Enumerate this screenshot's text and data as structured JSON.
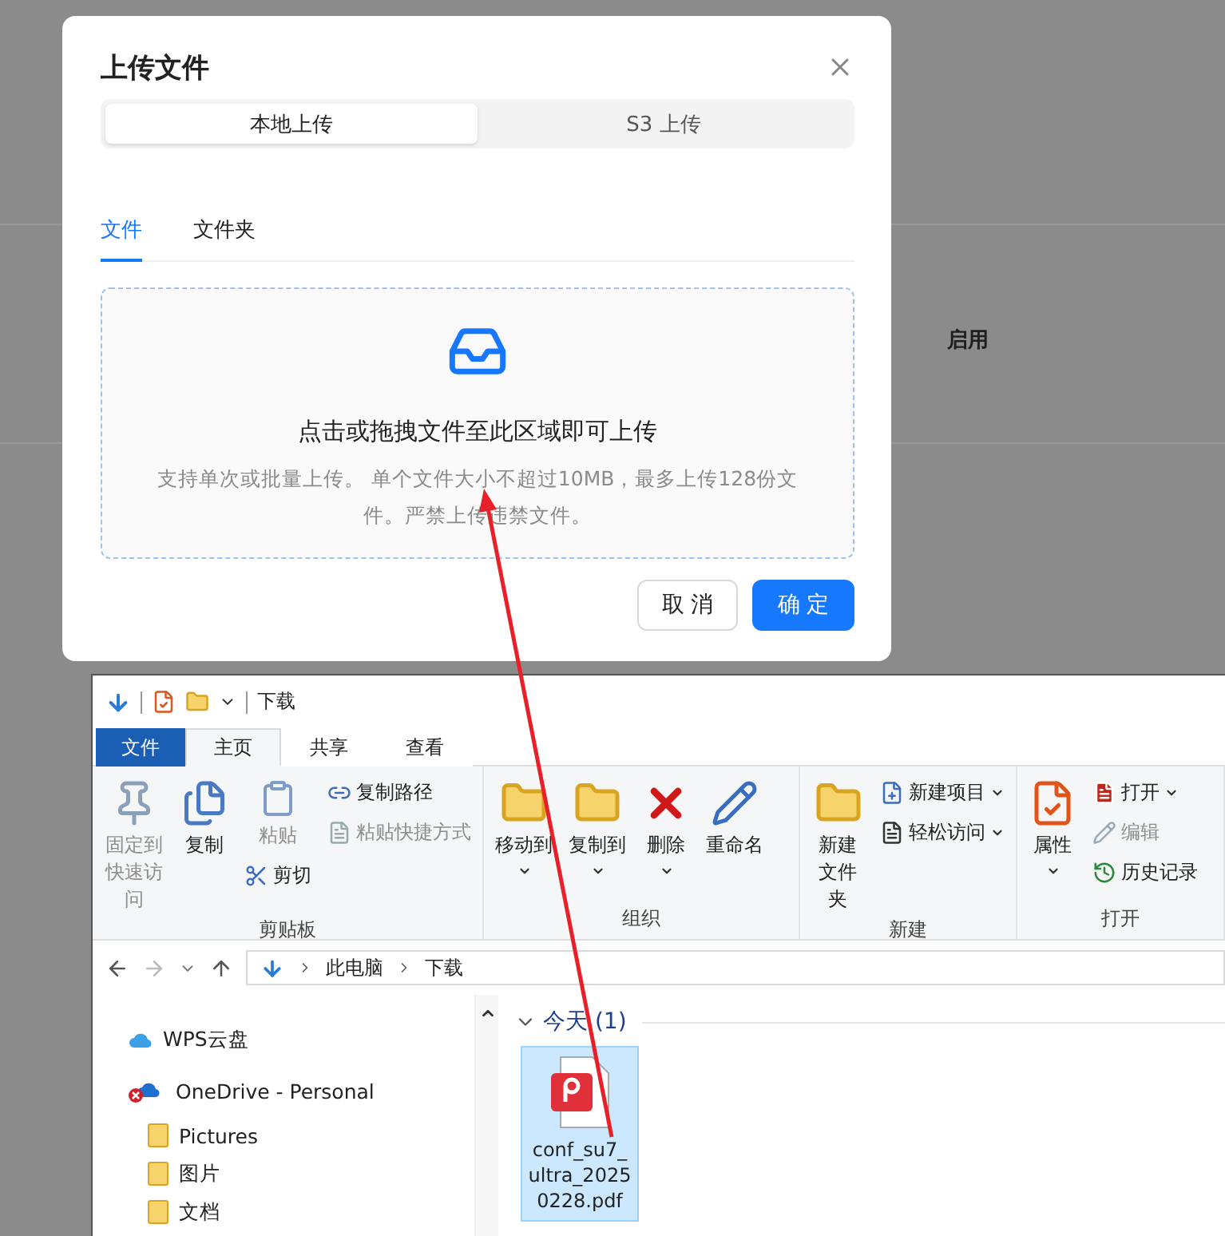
{
  "background": {
    "column_header": "启用"
  },
  "dialog": {
    "title": "上传文件",
    "source_tabs": [
      {
        "label": "本地上传",
        "selected": true
      },
      {
        "label": "S3 上传",
        "selected": false
      }
    ],
    "tabs": [
      {
        "label": "文件",
        "selected": true
      },
      {
        "label": "文件夹",
        "selected": false
      }
    ],
    "dropzone": {
      "title": "点击或拖拽文件至此区域即可上传",
      "hint": "支持单次或批量上传。 单个文件大小不超过10MB，最多上传128份文件。严禁上传违禁文件。"
    },
    "buttons": [
      {
        "label": "取 消",
        "kind": "default"
      },
      {
        "label": "确 定",
        "kind": "primary"
      }
    ]
  },
  "explorer": {
    "title": "下载",
    "ribbon_tabs": [
      {
        "label": "文件",
        "kind": "file",
        "selected": false
      },
      {
        "label": "主页",
        "kind": "tab",
        "selected": true
      },
      {
        "label": "共享",
        "kind": "tab",
        "selected": false
      },
      {
        "label": "查看",
        "kind": "tab",
        "selected": false
      }
    ],
    "ribbon_groups": [
      {
        "label": "剪贴板",
        "columns": [
          [
            {
              "kind": "large",
              "label": "固定到快速访问",
              "disabled": true,
              "dropdown": false
            }
          ],
          [
            {
              "kind": "large",
              "label": "复制",
              "disabled": false,
              "dropdown": false
            }
          ],
          [
            {
              "kind": "medium",
              "label": "粘贴",
              "disabled": true,
              "dropdown": false
            },
            {
              "kind": "small",
              "label": "剪切",
              "disabled": false,
              "dropdown": false
            }
          ],
          [
            {
              "kind": "small",
              "label": "复制路径",
              "disabled": false,
              "dropdown": false
            },
            {
              "kind": "small",
              "label": "粘贴快捷方式",
              "disabled": true,
              "dropdown": false
            }
          ]
        ]
      },
      {
        "label": "组织",
        "columns": [
          [
            {
              "kind": "large",
              "label": "移动到",
              "disabled": false,
              "dropdown": true
            }
          ],
          [
            {
              "kind": "large",
              "label": "复制到",
              "disabled": false,
              "dropdown": true
            }
          ],
          [
            {
              "kind": "large",
              "label": "删除",
              "disabled": false,
              "dropdown": true
            }
          ],
          [
            {
              "kind": "large",
              "label": "重命名",
              "disabled": false,
              "dropdown": false
            }
          ]
        ]
      },
      {
        "label": "新建",
        "columns": [
          [
            {
              "kind": "large",
              "label": "新建文件夹",
              "disabled": false,
              "dropdown": false
            }
          ],
          [
            {
              "kind": "small",
              "label": "新建项目",
              "disabled": false,
              "dropdown": true
            },
            {
              "kind": "small",
              "label": "轻松访问",
              "disabled": false,
              "dropdown": true
            }
          ]
        ]
      },
      {
        "label": "打开",
        "columns": [
          [
            {
              "kind": "large",
              "label": "属性",
              "disabled": false,
              "dropdown": true
            }
          ],
          [
            {
              "kind": "small",
              "label": "打开",
              "disabled": false,
              "dropdown": true
            },
            {
              "kind": "small",
              "label": "编辑",
              "disabled": true,
              "dropdown": false
            },
            {
              "kind": "small",
              "label": "历史记录",
              "disabled": false,
              "dropdown": false
            }
          ]
        ]
      }
    ],
    "path": [
      "此电脑",
      "下载"
    ],
    "nav_items": [
      {
        "label": "WPS云盘",
        "kind": "cloud"
      },
      {
        "label": "OneDrive - Personal",
        "kind": "onedrive",
        "children": [
          {
            "label": "Pictures",
            "kind": "folder"
          },
          {
            "label": "图片",
            "kind": "folder"
          },
          {
            "label": "文档",
            "kind": "folder"
          }
        ]
      }
    ],
    "file_groups": [
      {
        "label": "今天 (1)",
        "files": [
          {
            "name": "conf_su7_ultra_20250228.pdf",
            "selected": true
          }
        ]
      }
    ]
  }
}
